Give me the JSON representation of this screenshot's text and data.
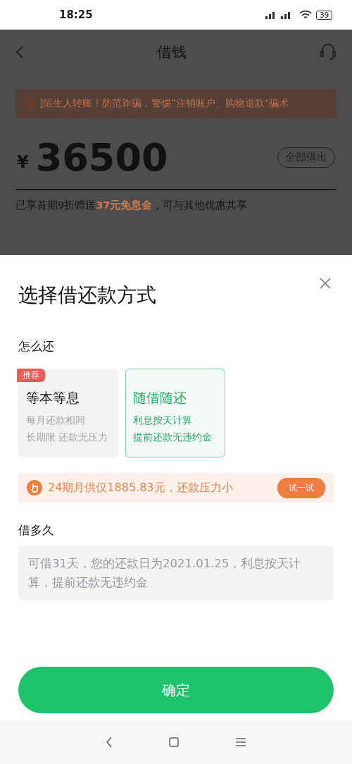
{
  "status_bar": {
    "time": "18:25",
    "battery": "39"
  },
  "header": {
    "title": "借钱"
  },
  "warning": {
    "text": "]陌生人转账！防范诈骗，警惕\"注销账户、购物退款\"骗术"
  },
  "amount": {
    "currency": "¥",
    "value": "36500",
    "button": "全部借出"
  },
  "promo": {
    "text": "已享首期9折赠送**37元免息金**，可与其他优惠共享"
  },
  "sheet": {
    "title": "选择借还款方式",
    "repay_label": "怎么还",
    "options": [
      {
        "title": "等本等息",
        "lines": [
          "每月还款相同",
          "长期限 还款无压力"
        ],
        "badge": "推荐",
        "selected": false
      },
      {
        "title": "随借随还",
        "lines": [
          "利息按天计算",
          "提前还款无违约金"
        ],
        "selected": true
      }
    ],
    "tip": {
      "text": "24期月供仅1885.83元，还款压力小",
      "button": "试一试"
    },
    "term_label": "借多久",
    "term_text": "可借31天，您的还款日为2021.01.25，利息按天计算，提前还款无违约金",
    "confirm": "确定"
  }
}
